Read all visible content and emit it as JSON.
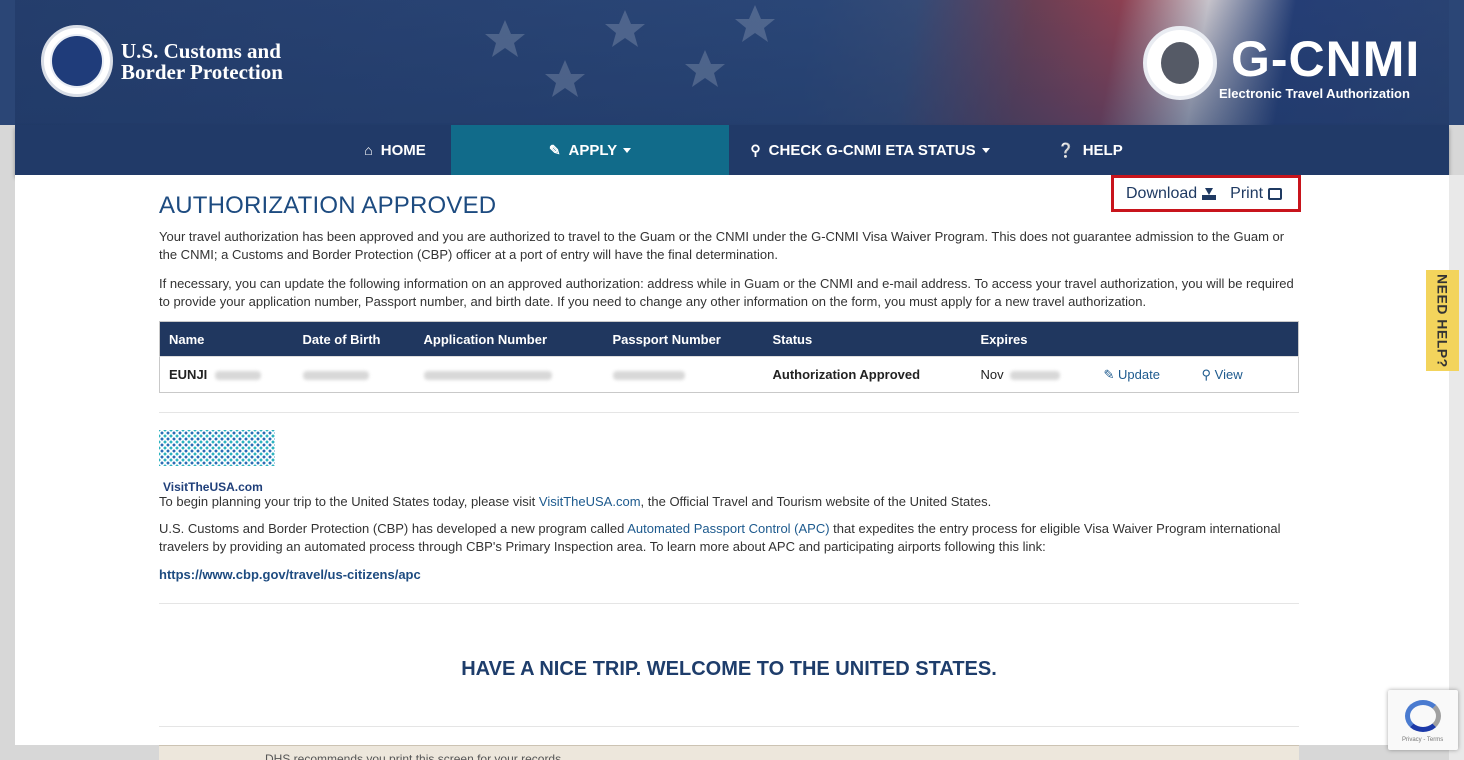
{
  "header": {
    "agency_line1": "U.S. Customs and",
    "agency_line2": "Border Protection",
    "program_title": "G-CNMI",
    "program_subtitle": "Electronic Travel Authorization"
  },
  "nav": {
    "items": [
      {
        "label": "HOME",
        "icon": "home-icon"
      },
      {
        "label": "APPLY",
        "icon": "pencil-icon",
        "active": true
      },
      {
        "label": "CHECK G-CNMI ETA STATUS",
        "icon": "search-icon"
      },
      {
        "label": "HELP",
        "icon": "question-circle-icon"
      }
    ]
  },
  "actions": {
    "download_label": "Download",
    "print_label": "Print"
  },
  "main": {
    "title": "AUTHORIZATION APPROVED",
    "para1": "Your travel authorization has been approved and you are authorized to travel to the Guam or the CNMI under the G-CNMI Visa Waiver Program. This does not guarantee admission to the Guam or the CNMI; a Customs and Border Protection (CBP) officer at a port of entry will have the final determination.",
    "para2": "If necessary, you can update the following information on an approved authorization: address while in Guam or the CNMI and e-mail address. To access your travel authorization, you will be required to provide your application number, Passport number, and birth date. If you need to change any other information on the form, you must apply for a new travel authorization."
  },
  "table": {
    "headers": [
      "Name",
      "Date of Birth",
      "Application Number",
      "Passport Number",
      "Status",
      "Expires"
    ],
    "row": {
      "name": "EUNJI",
      "status": "Authorization Approved",
      "expires": "Nov",
      "update_label": "Update",
      "view_label": "View"
    }
  },
  "visit": {
    "logo_text": "VisitTheUSA.com",
    "para_before": "To begin planning your trip to the United States today, please visit ",
    "link": "VisitTheUSA.com",
    "para_after": ", the Official Travel and Tourism website of the United States."
  },
  "apc": {
    "para_before": "U.S. Customs and Border Protection (CBP) has developed a new program called ",
    "link": "Automated Passport Control (APC)",
    "para_after": " that expedites the entry process for eligible Visa Waiver Program international travelers by providing an automated process through CBP's Primary Inspection area. To learn more about APC and participating airports following this link:",
    "url": "https://www.cbp.gov/travel/us-citizens/apc"
  },
  "welcome": "HAVE A NICE TRIP. WELCOME TO THE UNITED STATES.",
  "bottom_note": "DHS recommends you print this screen for your records.",
  "need_help": "NEED HELP?",
  "recaptcha_text": "Privacy - Terms",
  "colors": {
    "nav_bg": "#213a68",
    "nav_active": "#116b8a",
    "title_blue": "#1d4b80",
    "highlight_red": "#c8141c",
    "help_tab": "#f3d45c"
  }
}
